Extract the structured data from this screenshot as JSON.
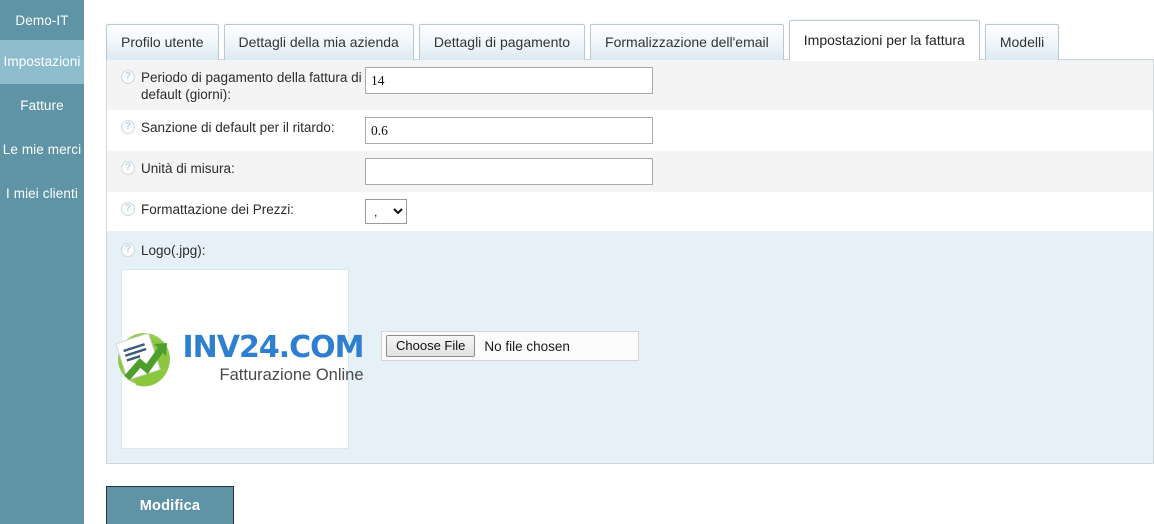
{
  "sidebar": {
    "items": [
      {
        "label": "Demo-IT",
        "active": false,
        "name": "sidebar-item-demo-it"
      },
      {
        "label": "Impostazioni",
        "active": true,
        "name": "sidebar-item-impostazioni"
      },
      {
        "label": "Fatture",
        "active": false,
        "name": "sidebar-item-fatture"
      },
      {
        "label": "Le mie merci",
        "active": false,
        "name": "sidebar-item-le-mie-merci"
      },
      {
        "label": "I miei clienti",
        "active": false,
        "name": "sidebar-item-i-miei-clienti"
      }
    ],
    "background_color": "#5f93a6",
    "active_color": "#8dbdcd"
  },
  "tabs": [
    {
      "label": "Profilo utente",
      "active": false
    },
    {
      "label": "Dettagli della mia azienda",
      "active": false
    },
    {
      "label": "Dettagli di pagamento",
      "active": false
    },
    {
      "label": "Formalizzazione dell'email",
      "active": false
    },
    {
      "label": "Impostazioni per la fattura",
      "active": true
    },
    {
      "label": "Modelli",
      "active": false
    }
  ],
  "form": {
    "help_icon": "?",
    "rows": [
      {
        "label": "Periodo di pagamento della fattura di default (giorni):",
        "value": "14",
        "placeholder": "",
        "type": "text"
      },
      {
        "label": "Sanzione di default per il ritardo:",
        "value": "0.6",
        "placeholder": "",
        "type": "text"
      },
      {
        "label": "Unità di misura:",
        "value": "",
        "placeholder": "",
        "type": "text"
      },
      {
        "label": "Formattazione dei Prezzi:",
        "value": ",",
        "options": [
          ",",
          "."
        ],
        "type": "select"
      }
    ],
    "logo_row": {
      "label": "Logo(.jpg):",
      "file_button_label": "Choose File",
      "file_status": "No file chosen",
      "logo": {
        "title": "INV24.COM",
        "subtitle": "Fatturazione Online",
        "brand_color": "#2f7fd0",
        "accent_color": "#8cc63f"
      }
    }
  },
  "actions": {
    "submit_label": "Modifica"
  }
}
